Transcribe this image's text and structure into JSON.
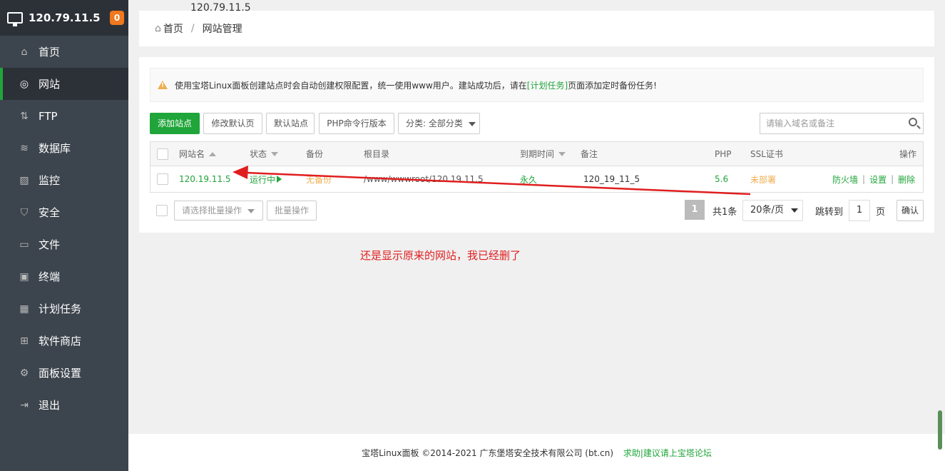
{
  "sidebar": {
    "server_ip": "120.79.11.5",
    "badge": "0",
    "items": [
      {
        "label": "首页",
        "icon": "home-icon",
        "glyph": "⌂"
      },
      {
        "label": "网站",
        "icon": "globe-icon",
        "glyph": "◎"
      },
      {
        "label": "FTP",
        "icon": "ftp-icon",
        "glyph": "⇅"
      },
      {
        "label": "数据库",
        "icon": "database-icon",
        "glyph": "≋"
      },
      {
        "label": "监控",
        "icon": "monitor-icon",
        "glyph": "▨"
      },
      {
        "label": "安全",
        "icon": "shield-icon",
        "glyph": "⛉"
      },
      {
        "label": "文件",
        "icon": "folder-icon",
        "glyph": "▭"
      },
      {
        "label": "终端",
        "icon": "terminal-icon",
        "glyph": "▣"
      },
      {
        "label": "计划任务",
        "icon": "calendar-icon",
        "glyph": "▦"
      },
      {
        "label": "软件商店",
        "icon": "apps-icon",
        "glyph": "⊞"
      },
      {
        "label": "面板设置",
        "icon": "gear-icon",
        "glyph": "⚙"
      },
      {
        "label": "退出",
        "icon": "logout-icon",
        "glyph": "⇥"
      }
    ]
  },
  "floating_ip": "120.79.11.5",
  "breadcrumb": {
    "home": "首页",
    "separator": "/",
    "current": "网站管理"
  },
  "notice": {
    "text_before": "使用宝塔Linux面板创建站点时会自动创建权限配置，统一使用www用户。建站成功后，请在",
    "link": "[计划任务]",
    "text_after": "页面添加定时备份任务!"
  },
  "toolbar": {
    "add_site": "添加站点",
    "edit_default_page": "修改默认页",
    "default_site": "默认站点",
    "php_cli": "PHP命令行版本",
    "category_select": "分类: 全部分类"
  },
  "search": {
    "placeholder": "请输入域名或备注"
  },
  "table": {
    "headers": {
      "name": "网站名",
      "status": "状态",
      "backup": "备份",
      "root": "根目录",
      "expire": "到期时间",
      "note": "备注",
      "php": "PHP",
      "ssl": "SSL证书",
      "actions": "操作"
    },
    "rows": [
      {
        "name": "120.19.11.5",
        "status": "运行中",
        "backup": "无备份",
        "root": "/www/wwwroot/120.19.11.5",
        "expire": "永久",
        "note": "120_19_11_5",
        "php": "5.6",
        "ssl": "未部署",
        "action_firewall": "防火墙",
        "action_settings": "设置",
        "action_delete": "删除"
      }
    ]
  },
  "batch": {
    "select_placeholder": "请选择批量操作",
    "button": "批量操作"
  },
  "pagination": {
    "current_page": "1",
    "total": "共1条",
    "per_page": "20条/页",
    "jump_label": "跳转到",
    "jump_value": "1",
    "page_unit": "页",
    "confirm": "确认"
  },
  "annotation": "还是显示原来的网站，我已经删了",
  "footer": {
    "copyright": "宝塔Linux面板 ©2014-2021 广东堡塔安全技术有限公司 (bt.cn)",
    "help_link": "求助|建议请上宝塔论坛"
  },
  "colors": {
    "accent": "#20a53a",
    "sidebar": "#3c444d",
    "annotation": "#e01e1e",
    "warning": "#f0ad4e"
  }
}
